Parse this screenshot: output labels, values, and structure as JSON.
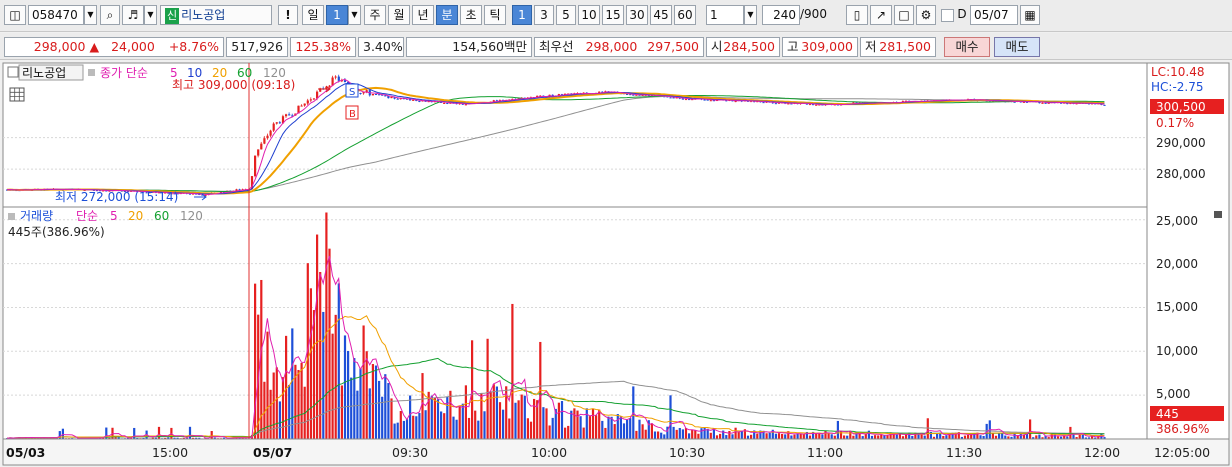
{
  "toolbar": {
    "code": "058470",
    "name_badge": "신",
    "name": "리노공업",
    "excl": "!",
    "periods": [
      "일",
      "1",
      "주",
      "월",
      "년",
      "분",
      "초",
      "틱"
    ],
    "intervals": [
      "1",
      "3",
      "5",
      "10",
      "15",
      "30",
      "45",
      "60"
    ],
    "interval_value": "1",
    "count_value": "240",
    "count_total": "/900",
    "d_label": "D",
    "date_value": "05/07"
  },
  "quote": {
    "price": "298,000",
    "change": "24,000",
    "change_pct": "+8.76%",
    "volume": "517,926",
    "volume_ratio": "125.38%",
    "turnover": "3.40%",
    "amount": "154,560백만",
    "best_label": "최우선",
    "ask": "298,000",
    "bid": "297,500",
    "open_label": "시",
    "open": "284,500",
    "high_label": "고",
    "high": "309,000",
    "low_label": "저",
    "low": "281,500",
    "buy_button": "매수",
    "sell_button": "매도"
  },
  "colors": {
    "up": "#e62020",
    "down": "#1e4fd8",
    "ma5": "#e020b0",
    "ma10": "#1f3fcf",
    "ma20": "#f0a000",
    "ma60": "#14a030",
    "ma120": "#909090"
  },
  "chart_data": [
    {
      "type": "candlestick",
      "title": "리노공업",
      "legend": [
        "종가 단순",
        "5",
        "10",
        "20",
        "60",
        "120"
      ],
      "legend_title": "종가 단순",
      "series_names": [
        "5",
        "10",
        "20",
        "60",
        "120"
      ],
      "y_range": [
        268000,
        313000
      ],
      "y_ticks": [
        "290,000",
        "280,000"
      ],
      "lc_label": "LC:10.48",
      "hc_label": "HC:-2.75",
      "current_price_label": "300,500",
      "current_pct_label": "0.17%",
      "annotations": {
        "high": "최고 309,000 (09:18)",
        "low": "최저 272,000 (15:14)",
        "sell_marker": "S",
        "buy_marker": "B"
      },
      "points": [
        {
          "t": "05/03 14:30",
          "y": 273500
        },
        {
          "t": "05/03 15:14",
          "y": 272000
        },
        {
          "t": "05/03 15:30",
          "y": 274000
        },
        {
          "t": "05/07 09:01",
          "y": 284500
        },
        {
          "t": "05/07 09:05",
          "y": 294000
        },
        {
          "t": "05/07 09:10",
          "y": 299000
        },
        {
          "t": "05/07 09:18",
          "y": 309000
        },
        {
          "t": "05/07 09:22",
          "y": 305000
        },
        {
          "t": "05/07 09:30",
          "y": 302500
        },
        {
          "t": "05/07 09:45",
          "y": 300500
        },
        {
          "t": "05/07 10:00",
          "y": 303000
        },
        {
          "t": "05/07 10:15",
          "y": 304500
        },
        {
          "t": "05/07 10:30",
          "y": 302500
        },
        {
          "t": "05/07 11:00",
          "y": 300500
        },
        {
          "t": "05/07 11:30",
          "y": 302000
        },
        {
          "t": "05/07 12:00",
          "y": 300500
        }
      ]
    },
    {
      "type": "bar",
      "title": "거래량",
      "legend": [
        "단순",
        "5",
        "20",
        "60",
        "120"
      ],
      "legend_title": "단순",
      "series_names": [
        "5",
        "20",
        "60",
        "120"
      ],
      "subtitle": "445주(386.96%)",
      "y_range": [
        0,
        26000
      ],
      "y_ticks": [
        "25,000",
        "20,000",
        "15,000",
        "10,000",
        "5,000"
      ],
      "current_value_label": "445",
      "current_pct_label": "386.96%",
      "values": [
        {
          "t": "05/07 09:01",
          "v": 24000
        },
        {
          "t": "05/07 09:03",
          "v": 10500
        },
        {
          "t": "05/07 09:10",
          "v": 14000
        },
        {
          "t": "05/07 09:16",
          "v": 21500
        },
        {
          "t": "05/07 09:18",
          "v": 16500
        },
        {
          "t": "05/07 09:22",
          "v": 14000
        },
        {
          "t": "05/07 09:30",
          "v": 4000
        },
        {
          "t": "05/07 09:50",
          "v": 5500
        },
        {
          "t": "05/07 10:00",
          "v": 4000
        },
        {
          "t": "05/07 10:30",
          "v": 1200
        },
        {
          "t": "05/07 11:00",
          "v": 800
        },
        {
          "t": "05/07 12:00",
          "v": 445
        }
      ]
    }
  ],
  "x_axis": [
    "05/03",
    "15:00",
    "05/07",
    "09:30",
    "10:00",
    "10:30",
    "11:00",
    "11:30",
    "12:00",
    "12:05:00"
  ]
}
